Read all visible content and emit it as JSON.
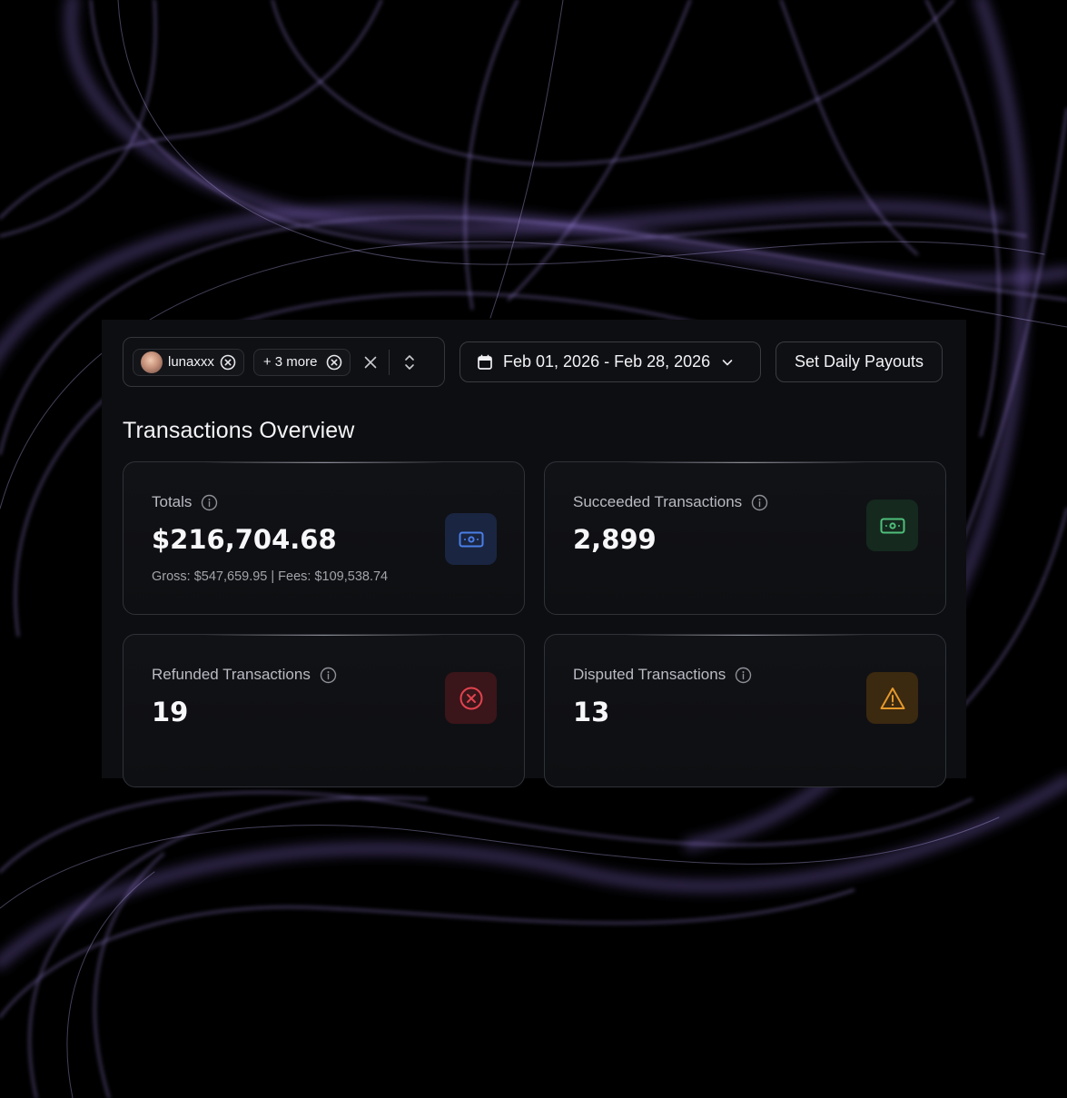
{
  "filters": {
    "user_chip": {
      "label": "lunaxxx"
    },
    "more_chip": {
      "label": "+ 3 more"
    }
  },
  "date_range": {
    "label": "Feb 01, 2026 - Feb 28, 2026"
  },
  "payouts_button": {
    "label": "Set Daily Payouts"
  },
  "section": {
    "title": "Transactions Overview"
  },
  "cards": [
    {
      "label": "Totals",
      "value": "$216,704.68",
      "sub": "Gross: $547,659.95 | Fees: $109,538.74",
      "icon": "cash-icon",
      "accent": "#4a7ee8"
    },
    {
      "label": "Succeeded Transactions",
      "value": "2,899",
      "icon": "cash-icon",
      "accent": "#4fbf7b"
    },
    {
      "label": "Refunded Transactions",
      "value": "19",
      "icon": "x-circle-icon",
      "accent": "#e0434f"
    },
    {
      "label": "Disputed Transactions",
      "value": "13",
      "icon": "warning-icon",
      "accent": "#e6992a"
    }
  ],
  "colors": {
    "background": "#000000",
    "panel": "#0d0e11",
    "smoke": "#8b6fd6"
  }
}
